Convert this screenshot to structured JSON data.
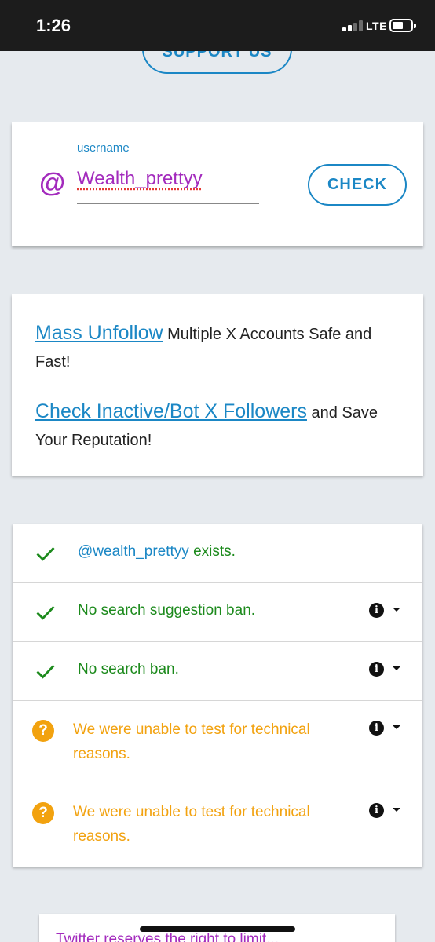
{
  "status_bar": {
    "time": "1:26",
    "network": "LTE"
  },
  "header": {
    "support_label": "SUPPORT US"
  },
  "search": {
    "at_symbol": "@",
    "label": "username",
    "value": "Wealth_prettyy",
    "check_label": "CHECK"
  },
  "promo": {
    "line1_link": "Mass Unfollow",
    "line1_text": " Multiple X Accounts Safe and Fast!",
    "line2_link": "Check Inactive/Bot X Followers",
    "line2_text": " and Save Your Reputation!"
  },
  "results": [
    {
      "status": "ok",
      "handle": "@wealth_prettyy",
      "text": " exists."
    },
    {
      "status": "ok",
      "text": "No search suggestion ban."
    },
    {
      "status": "ok",
      "text": "No search ban."
    },
    {
      "status": "unknown",
      "text": "We were unable to test for technical reasons."
    },
    {
      "status": "unknown",
      "text": "We were unable to test for technical reasons."
    }
  ],
  "footer": {
    "note": "Twitter reserves the right to limit..."
  },
  "colors": {
    "accent_blue": "#1b87c5",
    "purple": "#a32bbd",
    "success_green": "#1c8a1c",
    "warning_orange": "#f2a20f"
  },
  "icons": [
    "signal-icon",
    "battery-icon",
    "at-icon",
    "check-icon",
    "question-icon",
    "info-icon",
    "caret-down-icon"
  ]
}
